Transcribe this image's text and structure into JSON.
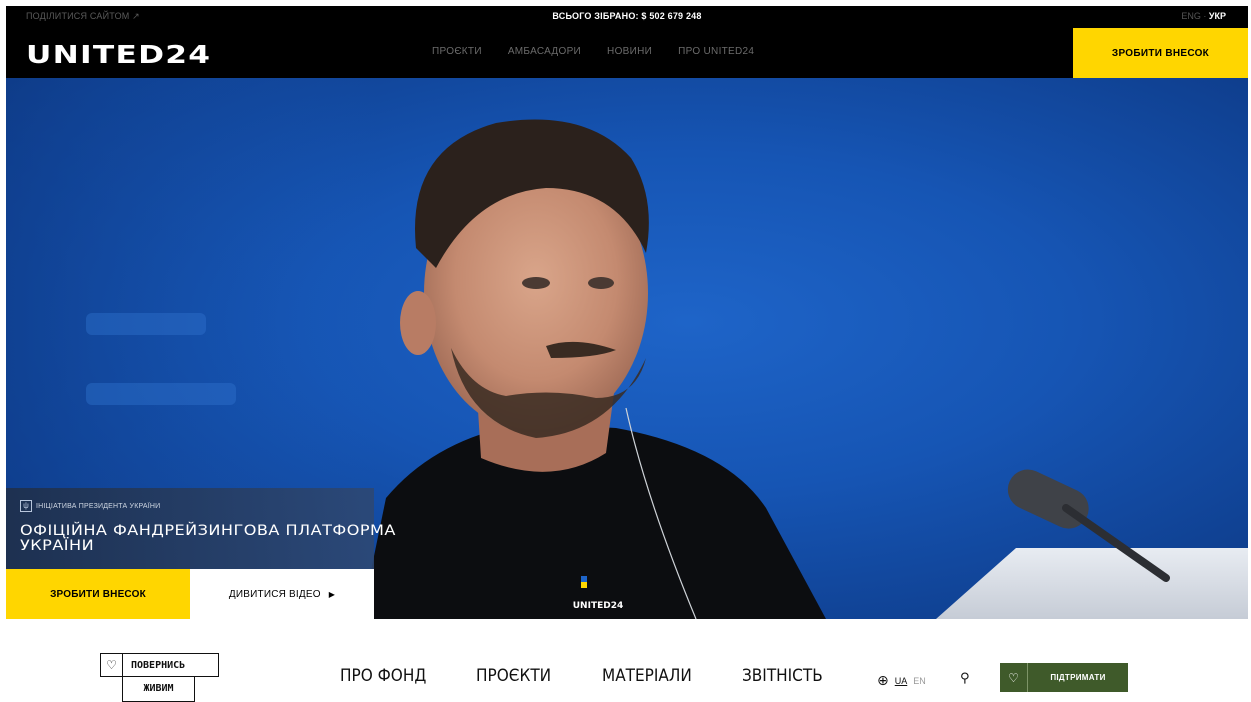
{
  "united24": {
    "topbar": {
      "share_label": "ПОДІЛИТИСЯ САЙТОМ ↗",
      "total_raised": "ВСЬОГО ЗІБРАНО: $ 502 679 248",
      "lang_inactive": "ENG",
      "lang_active": "УКР"
    },
    "logo": "UNITED24",
    "nav": [
      {
        "label": "ПРОЄКТИ"
      },
      {
        "label": "АМБАСАДОРИ"
      },
      {
        "label": "НОВИНИ"
      },
      {
        "label": "ПРО UNITED24"
      }
    ],
    "donate_top_label": "ЗРОБИТИ ВНЕСОК",
    "hero": {
      "initiative_label": "ІНІЦІАТИВА ПРЕЗИДЕНТА УКРАЇНИ",
      "headline": "ОФІЦІЙНА ФАНДРЕЙЗИНГОВА ПЛАТФОРМА УКРАЇНИ",
      "donate_label": "ЗРОБИТИ ВНЕСОК",
      "video_label": "ДИВИТИСЯ ВІДЕО",
      "sweater_logo": "UNITED24"
    }
  },
  "povernys": {
    "logo_line1": "ПОВЕРНИСЬ",
    "logo_line2": "ЖИВИМ",
    "nav": [
      {
        "label": "ПРО ФОНД"
      },
      {
        "label": "ПРОЄКТИ"
      },
      {
        "label": "МАТЕРІАЛИ"
      },
      {
        "label": "ЗВІТНІСТЬ"
      }
    ],
    "lang_ua": "UA",
    "lang_en": "EN",
    "support_label": "ПІДТРИМАТИ"
  },
  "colors": {
    "u24_yellow": "#ffd600",
    "hero_blue": "#1655b4",
    "pz_green": "#3f5a2a"
  },
  "icons": [
    "external-link-icon",
    "play-icon",
    "trident-icon",
    "heart-icon",
    "globe-icon",
    "search-icon"
  ]
}
